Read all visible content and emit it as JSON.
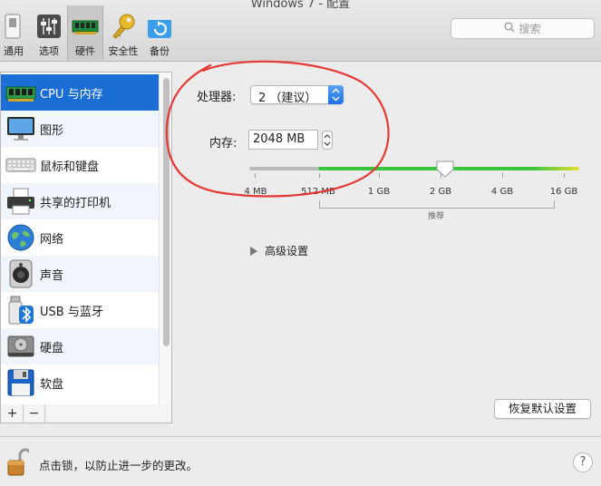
{
  "window": {
    "title": "Windows 7 - 配置"
  },
  "toolbar": {
    "tabs": [
      {
        "label": "通用",
        "icon": "general-switch-icon"
      },
      {
        "label": "选项",
        "icon": "options-sliders-icon"
      },
      {
        "label": "硬件",
        "icon": "hardware-chip-icon",
        "active": true
      },
      {
        "label": "安全性",
        "icon": "key-icon"
      },
      {
        "label": "备份",
        "icon": "backup-icon"
      }
    ],
    "search_placeholder": "搜索"
  },
  "sidebar": {
    "items": [
      {
        "label": "CPU 与内存",
        "icon": "memory-chip-icon",
        "selected": true
      },
      {
        "label": "图形",
        "icon": "monitor-icon"
      },
      {
        "label": "鼠标和键盘",
        "icon": "keyboard-icon"
      },
      {
        "label": "共享的打印机",
        "icon": "printer-icon"
      },
      {
        "label": "网络",
        "icon": "globe-icon"
      },
      {
        "label": "声音",
        "icon": "speaker-icon"
      },
      {
        "label": "USB 与蓝牙",
        "icon": "usb-bluetooth-icon"
      },
      {
        "label": "硬盘",
        "icon": "hard-disk-icon"
      },
      {
        "label": "软盘",
        "icon": "floppy-disk-icon"
      }
    ],
    "add_label": "+",
    "remove_label": "−"
  },
  "cpu": {
    "label": "处理器:",
    "value": "2 （建议）"
  },
  "memory": {
    "label": "内存:",
    "value": "2048 MB",
    "scale_labels": [
      "4 MB",
      "512 MB",
      "1 GB",
      "2 GB",
      "4 GB",
      "16 GB"
    ],
    "recommended_label": "推荐"
  },
  "advanced": {
    "label": "高级设置"
  },
  "restore_button": "恢复默认设置",
  "footer": {
    "lock_text": "点击锁，以防止进一步的更改。",
    "help_label": "?"
  },
  "colors": {
    "selection_blue": "#1b6ed6",
    "slider_green": "#39c43d",
    "slider_yellow": "#e8e033",
    "annotation_red": "#e53935"
  }
}
